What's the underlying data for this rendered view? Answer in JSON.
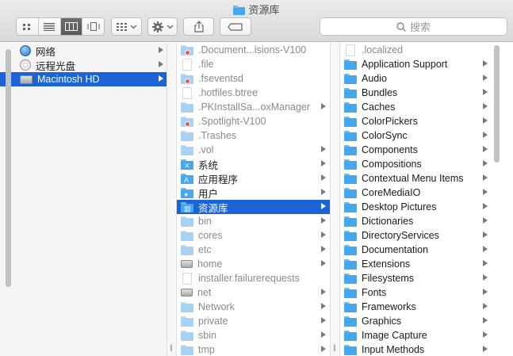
{
  "window": {
    "title": "资源库"
  },
  "toolbar": {
    "views": [
      "icon-view",
      "list-view",
      "column-view",
      "cover-flow-view"
    ],
    "active_view": 2,
    "search_placeholder": "搜索"
  },
  "column1": {
    "items": [
      {
        "label": "网络",
        "icon": "network-globe-icon",
        "arrow": true
      },
      {
        "label": "远程光盘",
        "icon": "remote-disc-icon",
        "arrow": true
      },
      {
        "label": "Macintosh HD",
        "icon": "hard-disk-icon",
        "arrow": true,
        "selected": true
      }
    ]
  },
  "column2": {
    "items": [
      {
        "label": ".Document...isions-V100",
        "icon": "folder-badge",
        "dim": true,
        "arrow": false
      },
      {
        "label": ".file",
        "icon": "doc",
        "dim": true,
        "arrow": false
      },
      {
        "label": ".fseventsd",
        "icon": "folder-badge",
        "dim": true,
        "arrow": false
      },
      {
        "label": ".hotfiles.btree",
        "icon": "doc",
        "dim": true,
        "arrow": false
      },
      {
        "label": ".PKInstallSa...oxManager",
        "icon": "folder",
        "dim": true,
        "arrow": true
      },
      {
        "label": ".Spotlight-V100",
        "icon": "folder-badge",
        "dim": true,
        "arrow": false
      },
      {
        "label": ".Trashes",
        "icon": "folder",
        "dim": true,
        "arrow": false
      },
      {
        "label": ".vol",
        "icon": "folder",
        "dim": true,
        "arrow": true
      },
      {
        "label": "系统",
        "icon": "system-folder",
        "dim": false,
        "arrow": true
      },
      {
        "label": "应用程序",
        "icon": "applications-folder",
        "dim": false,
        "arrow": true
      },
      {
        "label": "用户",
        "icon": "users-folder",
        "dim": false,
        "arrow": true
      },
      {
        "label": "资源库",
        "icon": "library-folder",
        "dim": false,
        "arrow": true,
        "selected": true
      },
      {
        "label": "bin",
        "icon": "folder",
        "dim": true,
        "arrow": true
      },
      {
        "label": "cores",
        "icon": "folder",
        "dim": true,
        "arrow": true
      },
      {
        "label": "etc",
        "icon": "folder",
        "dim": true,
        "arrow": true
      },
      {
        "label": "home",
        "icon": "disk",
        "dim": true,
        "arrow": true
      },
      {
        "label": "installer.failurerequests",
        "icon": "doc",
        "dim": true,
        "arrow": false
      },
      {
        "label": "net",
        "icon": "disk",
        "dim": true,
        "arrow": true
      },
      {
        "label": "Network",
        "icon": "folder",
        "dim": true,
        "arrow": true
      },
      {
        "label": "private",
        "icon": "folder",
        "dim": true,
        "arrow": true
      },
      {
        "label": "sbin",
        "icon": "folder",
        "dim": true,
        "arrow": true
      },
      {
        "label": "tmp",
        "icon": "folder",
        "dim": true,
        "arrow": true
      }
    ]
  },
  "column3": {
    "items": [
      {
        "label": ".localized",
        "icon": "doc",
        "dim": true,
        "arrow": false
      },
      {
        "label": "Application Support",
        "icon": "folder",
        "arrow": true
      },
      {
        "label": "Audio",
        "icon": "folder",
        "arrow": true
      },
      {
        "label": "Bundles",
        "icon": "folder",
        "arrow": true
      },
      {
        "label": "Caches",
        "icon": "folder",
        "arrow": true
      },
      {
        "label": "ColorPickers",
        "icon": "folder",
        "arrow": true
      },
      {
        "label": "ColorSync",
        "icon": "folder",
        "arrow": true
      },
      {
        "label": "Components",
        "icon": "folder",
        "arrow": true
      },
      {
        "label": "Compositions",
        "icon": "folder",
        "arrow": true
      },
      {
        "label": "Contextual Menu Items",
        "icon": "folder",
        "arrow": true
      },
      {
        "label": "CoreMediaIO",
        "icon": "folder",
        "arrow": true
      },
      {
        "label": "Desktop Pictures",
        "icon": "folder",
        "arrow": true
      },
      {
        "label": "Dictionaries",
        "icon": "folder",
        "arrow": true
      },
      {
        "label": "DirectoryServices",
        "icon": "folder",
        "arrow": true
      },
      {
        "label": "Documentation",
        "icon": "folder",
        "arrow": true
      },
      {
        "label": "Extensions",
        "icon": "folder",
        "arrow": true
      },
      {
        "label": "Filesystems",
        "icon": "folder",
        "arrow": true
      },
      {
        "label": "Fonts",
        "icon": "folder",
        "arrow": true
      },
      {
        "label": "Frameworks",
        "icon": "folder",
        "arrow": true
      },
      {
        "label": "Graphics",
        "icon": "folder",
        "arrow": true
      },
      {
        "label": "Image Capture",
        "icon": "folder",
        "arrow": true
      },
      {
        "label": "Input Methods",
        "icon": "folder",
        "arrow": true
      }
    ]
  },
  "colors": {
    "selection": "#1d63d8",
    "folder": "#45a7f0"
  }
}
